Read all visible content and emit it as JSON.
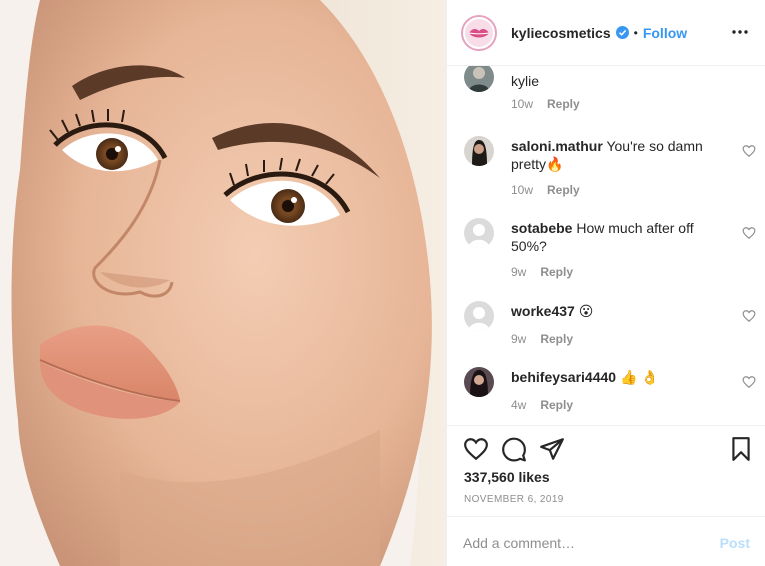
{
  "colors": {
    "link": "#3897f0",
    "muted": "#8e8e8e",
    "text": "#262626",
    "post_disabled": "#b9dffc",
    "border": "#efefef"
  },
  "header": {
    "username": "kyliecosmetics",
    "verified_icon": "verified-badge-icon",
    "separator": "•",
    "follow_label": "Follow",
    "more_icon": "more-options-icon"
  },
  "comments": [
    {
      "username": "",
      "text": "kylie",
      "time": "10w",
      "reply_label": "Reply"
    },
    {
      "username": "saloni.mathur",
      "text": "You're so damn pretty🔥",
      "time": "10w",
      "reply_label": "Reply"
    },
    {
      "username": "sotabebe",
      "text": "How much after off 50%?",
      "time": "9w",
      "reply_label": "Reply"
    },
    {
      "username": "worke437",
      "text": "😮",
      "time": "9w",
      "reply_label": "Reply"
    },
    {
      "username": "behifeysari4440",
      "text": "👍 👌",
      "time": "4w",
      "reply_label": "Reply"
    }
  ],
  "actions": {
    "like_icon": "heart-icon",
    "comment_icon": "comment-icon",
    "share_icon": "share-icon",
    "save_icon": "bookmark-icon"
  },
  "likes": "337,560 likes",
  "date": "NOVEMBER 6, 2019",
  "add_comment": {
    "placeholder": "Add a comment…",
    "value": "",
    "post_label": "Post"
  }
}
